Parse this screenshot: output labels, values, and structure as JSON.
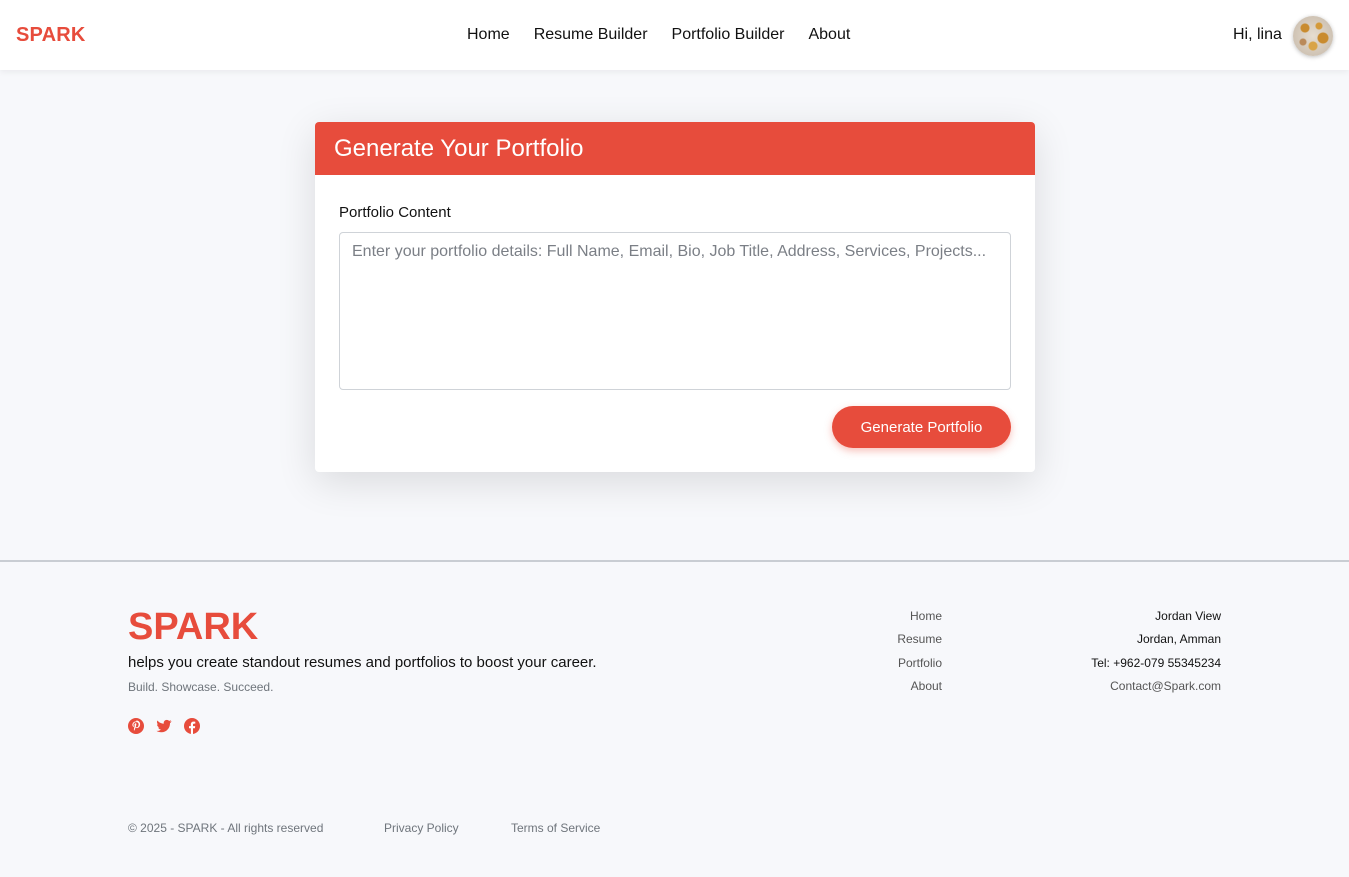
{
  "header": {
    "brand": "SPARK",
    "nav": [
      "Home",
      "Resume Builder",
      "Portfolio Builder",
      "About"
    ],
    "greeting": "Hi, lina"
  },
  "card": {
    "title": "Generate Your Portfolio",
    "label": "Portfolio Content",
    "placeholder": "Enter your portfolio details: Full Name, Email, Bio, Job Title, Address, Services, Projects...",
    "button": "Generate Portfolio"
  },
  "footer": {
    "brand": "SPARK",
    "tagline": "helps you create standout resumes and portfolios to boost your career.",
    "motto": "Build. Showcase. Succeed.",
    "socials": [
      "pinterest-icon",
      "twitter-icon",
      "facebook-icon"
    ],
    "links": [
      "Home",
      "Resume",
      "Portfolio",
      "About"
    ],
    "contact": {
      "line1": "Jordan View",
      "line2": "Jordan, Amman",
      "phone": "Tel: +962-079 55345234",
      "email": "Contact@Spark.com"
    },
    "copyright": "© 2025 - SPARK - All rights reserved",
    "privacy": "Privacy Policy",
    "terms": "Terms of Service"
  },
  "colors": {
    "accent": "#e74c3c",
    "background": "#f7f8fb"
  }
}
